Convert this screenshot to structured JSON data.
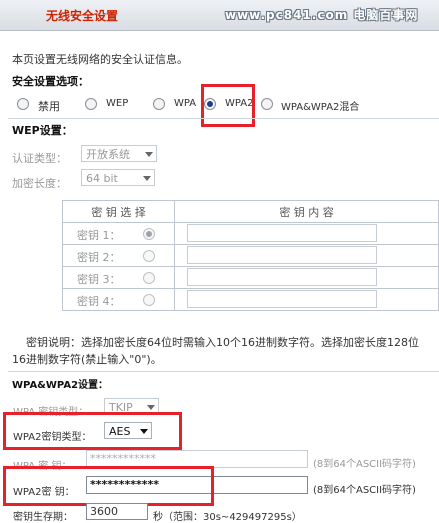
{
  "header": {
    "title": "无线安全设置",
    "watermark": "www.pc841.com 电脑百事网"
  },
  "intro": "本页设置无线网络的安全认证信息。",
  "security_options": {
    "label": "安全设置选项：",
    "options": [
      "禁用",
      "WEP",
      "WPA",
      "WPA2",
      "WPA&WPA2混合"
    ],
    "selected": "WPA2"
  },
  "wep": {
    "heading": "WEP设置：",
    "auth_label": "认证类型：",
    "auth_value": "开放系统",
    "enc_label": "加密长度：",
    "enc_value": "64 bit",
    "table": {
      "col_select": "密 钥 选 择",
      "col_content": "密 钥 内 容",
      "rows": [
        "密钥 1：",
        "密钥 2：",
        "密钥 3：",
        "密钥 4："
      ],
      "selected_index": 0
    },
    "note_line1": "密钥说明：选择加密长度64位时需输入10个16进制数字符。选择加密长度128位",
    "note_line2": "16进制数字符(禁止输入\"0\")。"
  },
  "wpa": {
    "heading": "WPA&WPA2设置：",
    "wpa_type_label": "WPA 密钥类型：",
    "wpa_type_value": "TKIP",
    "wpa2_type_label": "WPA2密钥类型：",
    "wpa2_type_value": "AES",
    "wpa_key_label": "WPA 密  钥：",
    "wpa_key_value": "************",
    "wpa_key_hint": "(8到64个ASCII码字符)",
    "wpa2_key_label": "WPA2密  钥：",
    "wpa2_key_value": "************",
    "wpa2_key_hint": "(8到64个ASCII码字符)",
    "lifetime_label": "密钥生存期：",
    "lifetime_value": "3600",
    "lifetime_hint": "秒（范围：30s~429497295s）"
  },
  "colors": {
    "highlight_box": "#e8202a",
    "title": "#cc2200"
  }
}
